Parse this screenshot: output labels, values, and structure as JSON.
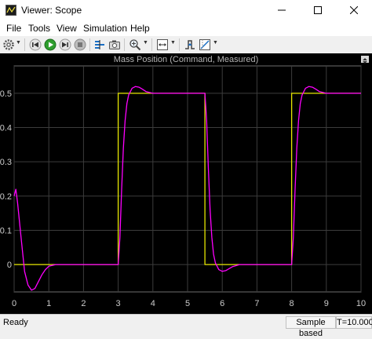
{
  "window": {
    "title": "Viewer: Scope",
    "app_icon": "scope-window-icon"
  },
  "window_controls": {
    "minimize": "minimize-icon",
    "maximize": "maximize-icon",
    "close": "close-icon"
  },
  "menu": [
    {
      "label": "File"
    },
    {
      "label": "Tools"
    },
    {
      "label": "View"
    },
    {
      "label": "Simulation"
    },
    {
      "label": "Help"
    }
  ],
  "toolbar": {
    "icons": [
      "gear-icon",
      "step-back-icon",
      "run-icon",
      "step-forward-icon",
      "stop-icon",
      "signal-selection-icon",
      "snapshot-icon",
      "zoom-icon",
      "autoscale-icon",
      "triggers-icon",
      "cursor-measurements-icon"
    ]
  },
  "plot": {
    "title": "Mass Position (Command, Measured)",
    "background": "#000000",
    "grid_color": "#3c3c3c",
    "axis_text_color": "#cccccc"
  },
  "chart_data": {
    "type": "line",
    "title": "Mass Position (Command, Measured)",
    "xlabel": "",
    "ylabel": "",
    "xlim": [
      0,
      10
    ],
    "ylim": [
      -0.08,
      0.58
    ],
    "xticks": [
      0,
      1,
      2,
      3,
      4,
      5,
      6,
      7,
      8,
      9,
      10
    ],
    "yticks": [
      0,
      0.1,
      0.2,
      0.3,
      0.4,
      0.5
    ],
    "grid": true,
    "legend": "none",
    "series": [
      {
        "color": "#e6e600",
        "x": [
          0,
          3,
          3,
          5.5,
          5.5,
          8,
          8,
          10
        ],
        "y": [
          0,
          0,
          0.5,
          0.5,
          0,
          0,
          0.5,
          0.5
        ]
      },
      {
        "color": "#ff00ff",
        "x": [
          0,
          0.05,
          0.1,
          0.2,
          0.3,
          0.4,
          0.5,
          0.6,
          0.7,
          0.8,
          0.9,
          1.0,
          1.2,
          1.5,
          2.0,
          2.5,
          3.0,
          3.05,
          3.1,
          3.15,
          3.2,
          3.25,
          3.3,
          3.4,
          3.5,
          3.6,
          3.7,
          3.8,
          4.0,
          4.2,
          4.5,
          5.0,
          5.5,
          5.55,
          5.6,
          5.65,
          5.7,
          5.75,
          5.8,
          5.9,
          6.0,
          6.1,
          6.2,
          6.3,
          6.5,
          6.7,
          7.0,
          7.5,
          8.0,
          8.05,
          8.1,
          8.15,
          8.2,
          8.25,
          8.3,
          8.4,
          8.5,
          8.6,
          8.7,
          8.8,
          9.0,
          9.2,
          9.5,
          10.0
        ],
        "y": [
          0.2,
          0.22,
          0.18,
          0.08,
          -0.02,
          -0.06,
          -0.075,
          -0.07,
          -0.05,
          -0.03,
          -0.015,
          -0.005,
          0.0,
          0.0,
          0.0,
          0.0,
          0.0,
          0.08,
          0.22,
          0.34,
          0.42,
          0.47,
          0.495,
          0.515,
          0.52,
          0.518,
          0.512,
          0.505,
          0.5,
          0.5,
          0.5,
          0.5,
          0.5,
          0.42,
          0.28,
          0.16,
          0.08,
          0.03,
          0.005,
          -0.015,
          -0.02,
          -0.018,
          -0.012,
          -0.006,
          0.0,
          0.0,
          0.0,
          0.0,
          0.0,
          0.08,
          0.22,
          0.34,
          0.42,
          0.47,
          0.495,
          0.515,
          0.52,
          0.518,
          0.512,
          0.505,
          0.5,
          0.5,
          0.5,
          0.5
        ]
      }
    ]
  },
  "status": {
    "text": "Ready",
    "mode": "Sample based",
    "time": "T=10.000"
  }
}
